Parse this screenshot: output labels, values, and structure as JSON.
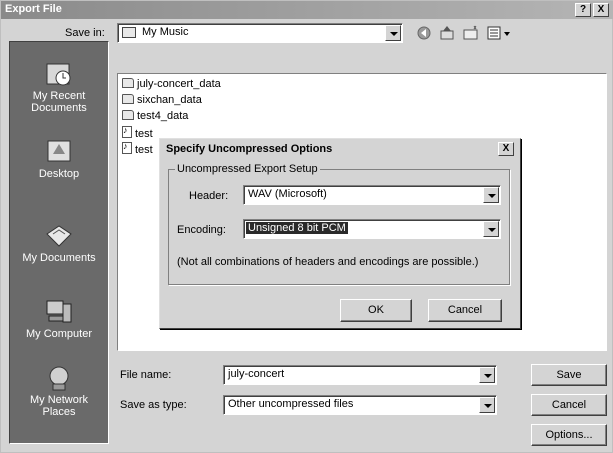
{
  "window": {
    "title": "Export File",
    "help_label": "?",
    "close_label": "X"
  },
  "save_in": {
    "label": "Save in:",
    "value": "My Music"
  },
  "places": [
    {
      "label": "My Recent Documents",
      "icon": "recent-documents-icon"
    },
    {
      "label": "Desktop",
      "icon": "desktop-icon"
    },
    {
      "label": "My Documents",
      "icon": "my-documents-icon"
    },
    {
      "label": "My Computer",
      "icon": "my-computer-icon"
    },
    {
      "label": "My Network Places",
      "icon": "network-places-icon"
    }
  ],
  "files": [
    {
      "name": "july-concert_data",
      "type": "folder"
    },
    {
      "name": "sixchan_data",
      "type": "folder"
    },
    {
      "name": "test4_data",
      "type": "folder"
    },
    {
      "name": "test",
      "type": "audio"
    },
    {
      "name": "test",
      "type": "audio"
    }
  ],
  "file_name": {
    "label": "File name:",
    "value": "july-concert"
  },
  "save_as_type": {
    "label": "Save as type:",
    "value": "Other uncompressed files"
  },
  "buttons": {
    "save": "Save",
    "cancel": "Cancel",
    "options": "Options..."
  },
  "dialog": {
    "title": "Specify Uncompressed Options",
    "close_label": "X",
    "group_title": "Uncompressed Export Setup",
    "header_label": "Header:",
    "header_value": "WAV (Microsoft)",
    "encoding_label": "Encoding:",
    "encoding_value": "Unsigned 8 bit PCM",
    "note": "(Not all combinations of headers and encodings are possible.)",
    "ok": "OK",
    "cancel": "Cancel"
  }
}
